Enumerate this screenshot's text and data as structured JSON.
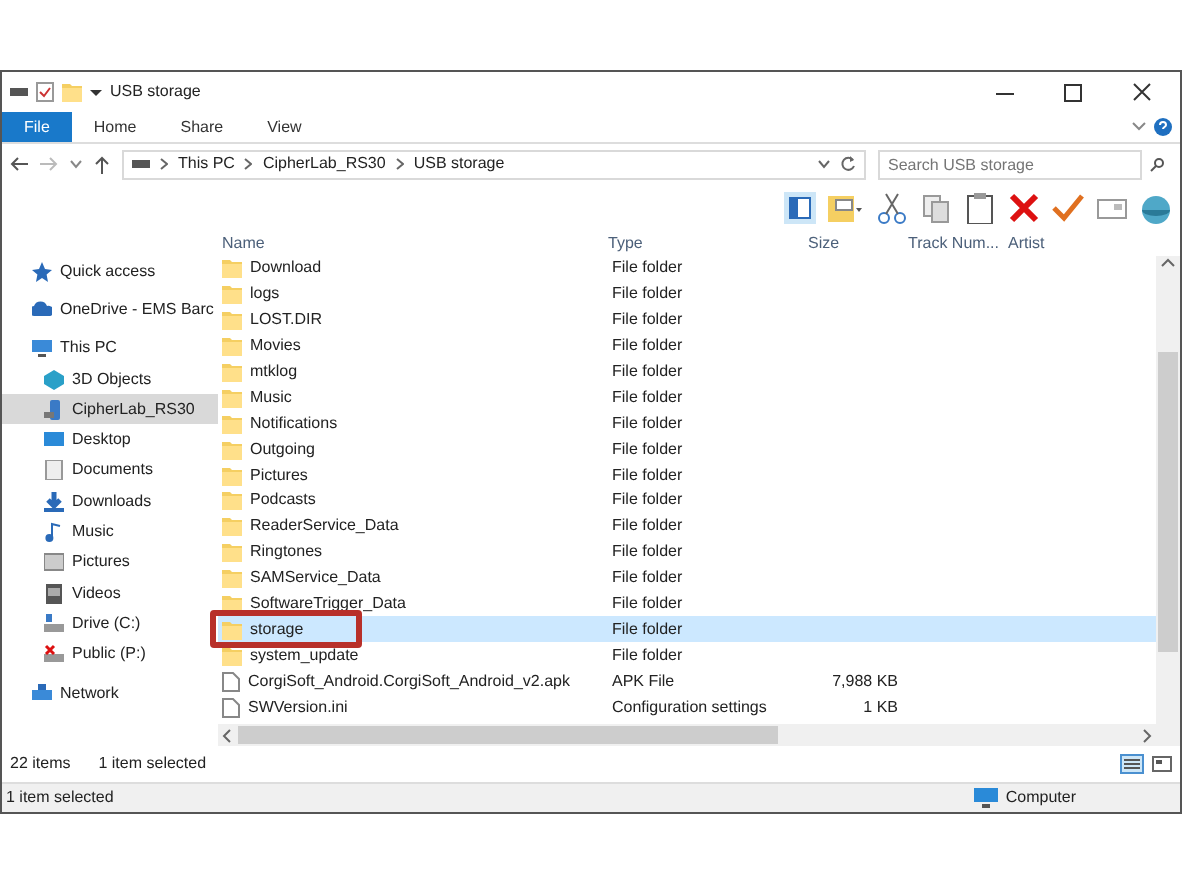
{
  "window": {
    "title": "USB storage"
  },
  "ribbon_tabs": [
    {
      "label": "File",
      "selected": true
    },
    {
      "label": "Home",
      "selected": false
    },
    {
      "label": "Share",
      "selected": false
    },
    {
      "label": "View",
      "selected": false
    }
  ],
  "address": {
    "path": [
      "This PC",
      "CipherLab_RS30",
      "USB storage"
    ]
  },
  "search": {
    "placeholder": "Search USB storage"
  },
  "sidebar": {
    "items": [
      {
        "label": "Quick access",
        "selected": false
      },
      {
        "label": "OneDrive - EMS Barc",
        "selected": false
      },
      {
        "label": "This PC",
        "selected": false,
        "children": [
          {
            "label": "3D Objects",
            "selected": false
          },
          {
            "label": "CipherLab_RS30",
            "selected": true
          },
          {
            "label": "Desktop",
            "selected": false
          },
          {
            "label": "Documents",
            "selected": false
          },
          {
            "label": "Downloads",
            "selected": false
          },
          {
            "label": "Music",
            "selected": false
          },
          {
            "label": "Pictures",
            "selected": false
          },
          {
            "label": "Videos",
            "selected": false
          },
          {
            "label": "Drive (C:)",
            "selected": false
          },
          {
            "label": "Public (P:)",
            "selected": false
          }
        ]
      },
      {
        "label": "Network",
        "selected": false
      }
    ]
  },
  "table": {
    "columns": [
      "Name",
      "Type",
      "Size",
      "Track Num...",
      "Artist"
    ],
    "rows": [
      {
        "kind": "folder",
        "name": "Download",
        "type": "File folder",
        "selected": false,
        "callout": false
      },
      {
        "kind": "folder",
        "name": "logs",
        "type": "File folder",
        "selected": false,
        "callout": false
      },
      {
        "kind": "folder",
        "name": "LOST.DIR",
        "type": "File folder",
        "selected": false,
        "callout": false
      },
      {
        "kind": "folder",
        "name": "Movies",
        "type": "File folder",
        "selected": false,
        "callout": false
      },
      {
        "kind": "folder",
        "name": "mtklog",
        "type": "File folder",
        "selected": false,
        "callout": false
      },
      {
        "kind": "folder",
        "name": "Music",
        "type": "File folder",
        "selected": false,
        "callout": false
      },
      {
        "kind": "folder",
        "name": "Notifications",
        "type": "File folder",
        "selected": false,
        "callout": false
      },
      {
        "kind": "folder",
        "name": "Outgoing",
        "type": "File folder",
        "selected": false,
        "callout": false
      },
      {
        "kind": "folder",
        "name": "Pictures",
        "type": "File folder",
        "selected": false,
        "callout": false
      },
      {
        "kind": "folder",
        "name": "Podcasts",
        "type": "File folder",
        "selected": false,
        "callout": false
      },
      {
        "kind": "folder",
        "name": "ReaderService_Data",
        "type": "File folder",
        "selected": false,
        "callout": false
      },
      {
        "kind": "folder",
        "name": "Ringtones",
        "type": "File folder",
        "selected": false,
        "callout": false
      },
      {
        "kind": "folder",
        "name": "SAMService_Data",
        "type": "File folder",
        "selected": false,
        "callout": false
      },
      {
        "kind": "folder",
        "name": "SoftwareTrigger_Data",
        "type": "File folder",
        "selected": false,
        "callout": false
      },
      {
        "kind": "folder",
        "name": "storage",
        "type": "File folder",
        "selected": true,
        "callout": true
      },
      {
        "kind": "folder",
        "name": "system_update",
        "type": "File folder",
        "selected": false,
        "callout": false
      },
      {
        "kind": "file",
        "name": "CorgiSoft_Android.CorgiSoft_Android_v2.apk",
        "type": "APK File",
        "size": "7,988 KB",
        "selected": false,
        "callout": false
      },
      {
        "kind": "file",
        "name": "SWVersion.ini",
        "type": "Configuration settings",
        "size": "1 KB",
        "selected": false,
        "callout": false
      }
    ]
  },
  "status": {
    "count": "22 items",
    "selection": "1 item selected"
  },
  "status_bar": {
    "text": "1 item selected",
    "zone": "Computer"
  }
}
